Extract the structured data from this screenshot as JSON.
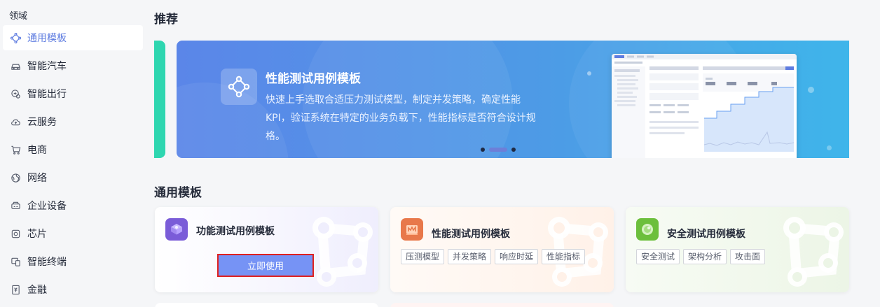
{
  "sidebar": {
    "title": "领域",
    "items": [
      {
        "label": "通用模板",
        "icon": "hub-icon",
        "active": true
      },
      {
        "label": "智能汽车",
        "icon": "car-icon"
      },
      {
        "label": "智能出行",
        "icon": "mobility-icon"
      },
      {
        "label": "云服务",
        "icon": "cloud-icon"
      },
      {
        "label": "电商",
        "icon": "cart-icon"
      },
      {
        "label": "网络",
        "icon": "globe-icon"
      },
      {
        "label": "企业设备",
        "icon": "device-icon"
      },
      {
        "label": "芯片",
        "icon": "chip-icon"
      },
      {
        "label": "智能终端",
        "icon": "terminal-icon"
      },
      {
        "label": "金融",
        "icon": "finance-icon"
      }
    ]
  },
  "recommend": {
    "section_title": "推荐",
    "banner": {
      "title": "性能测试用例模板",
      "description": "快速上手选取合适压力测试模型，制定并发策略，确定性能KPI，验证系统在特定的业务负载下，性能指标是否符合设计规格。",
      "icon": "hub-icon",
      "dots": 3,
      "active_dot": 2
    }
  },
  "templates": {
    "section_title": "通用模板",
    "cards": [
      {
        "title": "功能测试用例模板",
        "icon": "function-test-icon",
        "button_label": "立即使用",
        "tags": []
      },
      {
        "title": "性能测试用例模板",
        "icon": "performance-test-icon",
        "tags": [
          "压测模型",
          "并发策略",
          "响应时延",
          "性能指标"
        ]
      },
      {
        "title": "安全测试用例模板",
        "icon": "security-test-icon",
        "tags": [
          "安全测试",
          "架构分析",
          "攻击面"
        ]
      }
    ]
  },
  "colors": {
    "accent": "#5e7ce0",
    "button": "#7693f5",
    "highlight_border": "#e02020"
  }
}
